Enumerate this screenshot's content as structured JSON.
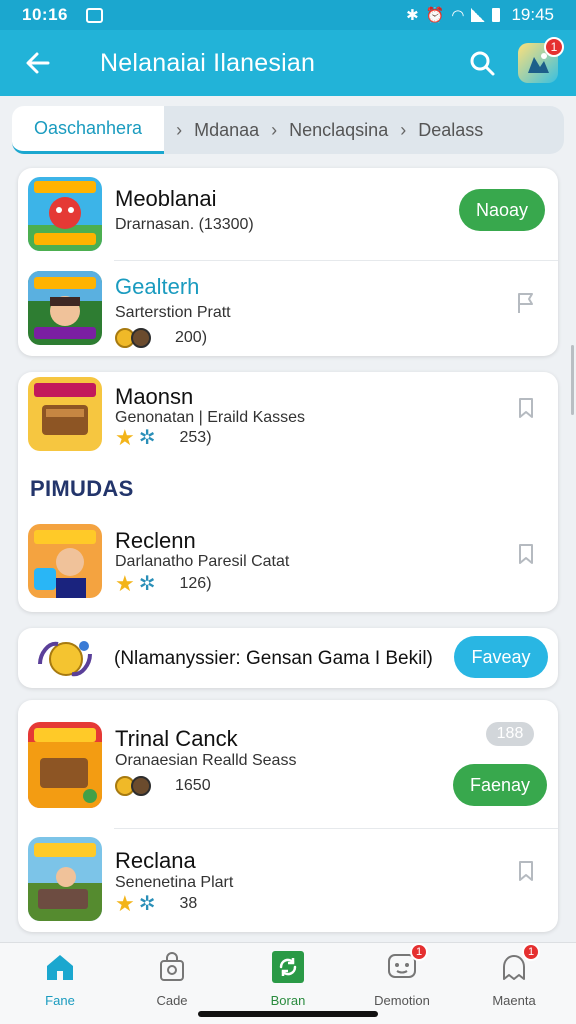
{
  "status_bar": {
    "time": "10:16",
    "clock": "19:45"
  },
  "app_bar": {
    "title": "Nelanaiai Ilanesian",
    "notification_count": "1"
  },
  "tabs": [
    {
      "label": "Oaschanhera"
    },
    {
      "label": "Mdanaa"
    },
    {
      "label": "Nenclaqsina"
    },
    {
      "label": "Dealass"
    }
  ],
  "section_heading": "PIMUDAS",
  "items": [
    {
      "title": "Meoblanai",
      "subtitle": "Drarnasan. (13300)",
      "action": "Naoay"
    },
    {
      "title": "Gealterh",
      "subtitle": "Sarterstion Pratt",
      "meta": "200)"
    },
    {
      "title": "Maonsn",
      "subtitle": "Genonatan | Eraild Kasses",
      "meta": "253)"
    },
    {
      "title": "Reclenn",
      "subtitle": "Darlanatho Paresil Catat",
      "meta": "126)"
    },
    {
      "title": "Trinal Canck",
      "subtitle": "Oranaesian Realld Seass",
      "meta": "1650",
      "badge": "188",
      "action": "Faenay"
    },
    {
      "title": "Reclana",
      "subtitle": "Senenetina Plart",
      "meta": "38"
    }
  ],
  "promo": {
    "text": "(Nlamanyssier: Gensan Gama I Bekil)",
    "action": "Faveay"
  },
  "bottom_nav": [
    {
      "label": "Fane"
    },
    {
      "label": "Cade"
    },
    {
      "label": "Boran"
    },
    {
      "label": "Demotion",
      "badge": "1"
    },
    {
      "label": "Maenta",
      "badge": "1"
    }
  ],
  "colors": {
    "primary": "#22b3d8",
    "accent_green": "#38a84d",
    "accent_blue": "#29b6e3",
    "badge_red": "#e53030",
    "heading_navy": "#23356b"
  }
}
